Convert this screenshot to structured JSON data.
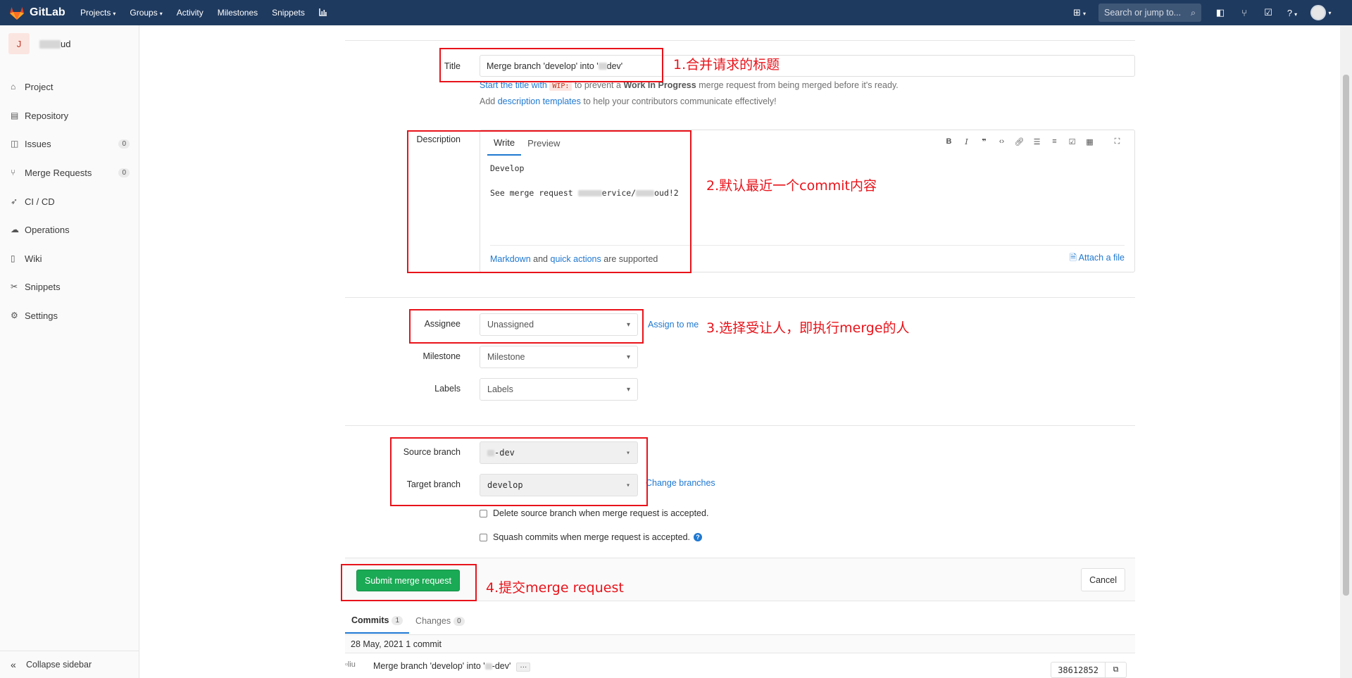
{
  "navbar": {
    "brand": "GitLab",
    "links": [
      {
        "label": "Projects",
        "dropdown": true
      },
      {
        "label": "Groups",
        "dropdown": true
      },
      {
        "label": "Activity",
        "dropdown": false
      },
      {
        "label": "Milestones",
        "dropdown": false
      },
      {
        "label": "Snippets",
        "dropdown": false
      }
    ],
    "search_placeholder": "Search or jump to..."
  },
  "sidebar": {
    "project_initial": "J",
    "project_name_suffix": "ud",
    "items": [
      {
        "label": "Project",
        "icon": "home-icon"
      },
      {
        "label": "Repository",
        "icon": "book-icon"
      },
      {
        "label": "Issues",
        "icon": "issues-icon",
        "count": "0"
      },
      {
        "label": "Merge Requests",
        "icon": "merge-request-icon",
        "count": "0"
      },
      {
        "label": "CI / CD",
        "icon": "rocket-icon"
      },
      {
        "label": "Operations",
        "icon": "cloud-icon"
      },
      {
        "label": "Wiki",
        "icon": "book-icon"
      },
      {
        "label": "Snippets",
        "icon": "scissors-icon"
      },
      {
        "label": "Settings",
        "icon": "gear-icon"
      }
    ],
    "collapse_label": "Collapse sidebar"
  },
  "form": {
    "title_label": "Title",
    "title_value_before": "Merge branch 'develop' into '",
    "title_value_after": "dev'",
    "wip_help_link": "Start the title with",
    "wip_code": "WIP:",
    "wip_help_rest_1": "to prevent a",
    "wip_help_bold": "Work In Progress",
    "wip_help_rest_2": "merge request from being merged before it's ready.",
    "templates_help_prefix": "Add",
    "templates_help_link": "description templates",
    "templates_help_rest": "to help your contributors communicate effectively!",
    "description_label": "Description",
    "tab_write": "Write",
    "tab_preview": "Preview",
    "description_line1": "Develop",
    "description_line2_prefix": "See merge request",
    "description_line2_mid": "ervice/",
    "description_line2_suffix": "oud!2",
    "markdown_link": "Markdown",
    "and_text": "and",
    "quick_actions_link": "quick actions",
    "supported_text": "are supported",
    "attach_file": "Attach a file",
    "assignee_label": "Assignee",
    "assignee_value": "Unassigned",
    "assign_to_me": "Assign to me",
    "milestone_label": "Milestone",
    "milestone_value": "Milestone",
    "labels_label": "Labels",
    "labels_value": "Labels",
    "source_branch_label": "Source branch",
    "source_branch_suffix": "-dev",
    "target_branch_label": "Target branch",
    "target_branch_value": "develop",
    "change_branches": "Change branches",
    "delete_source_label": "Delete source branch when merge request is accepted.",
    "squash_label": "Squash commits when merge request is accepted.",
    "submit_label": "Submit merge request",
    "cancel_label": "Cancel"
  },
  "commits": {
    "tab_commits": "Commits",
    "commits_count": "1",
    "tab_changes": "Changes",
    "changes_count": "0",
    "day_header": "28 May, 2021 1 commit",
    "avatar_alt": "liu",
    "commit_title_before": "Merge branch 'develop' into '",
    "commit_title_after": "-dev'",
    "sha": "38612852"
  },
  "annotations": {
    "a1": "1.合并请求的标题",
    "a2": "2.默认最近一个commit内容",
    "a3": "3.选择受让人，即执行merge的人",
    "a4": "4.提交merge request"
  },
  "colors": {
    "navbar": "#1f3a5f",
    "annotation": "#e8131a",
    "submit": "#1aaa55",
    "link": "#1f78d1"
  }
}
